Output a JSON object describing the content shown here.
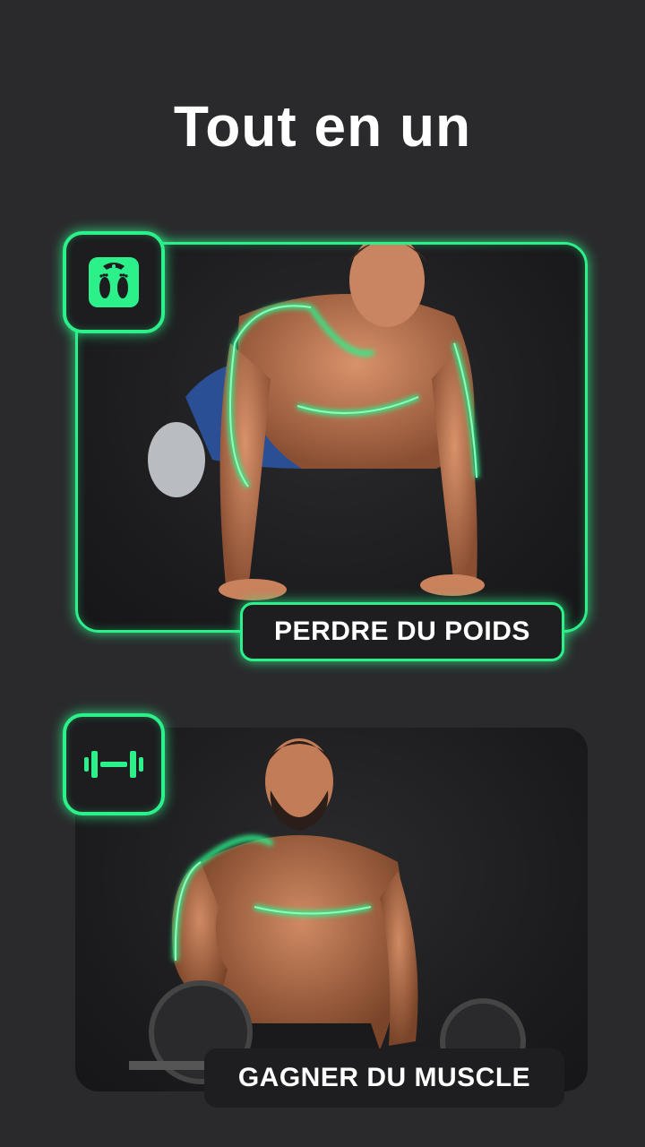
{
  "header": {
    "title": "Tout en un"
  },
  "goals": [
    {
      "label": "PERDRE DU POIDS",
      "icon": "scale-icon"
    },
    {
      "label": "GAGNER DU MUSCLE",
      "icon": "dumbbell-icon"
    }
  ],
  "colors": {
    "accent": "#2cf08a",
    "background": "#2a2a2c",
    "card": "#1b1b1d"
  }
}
